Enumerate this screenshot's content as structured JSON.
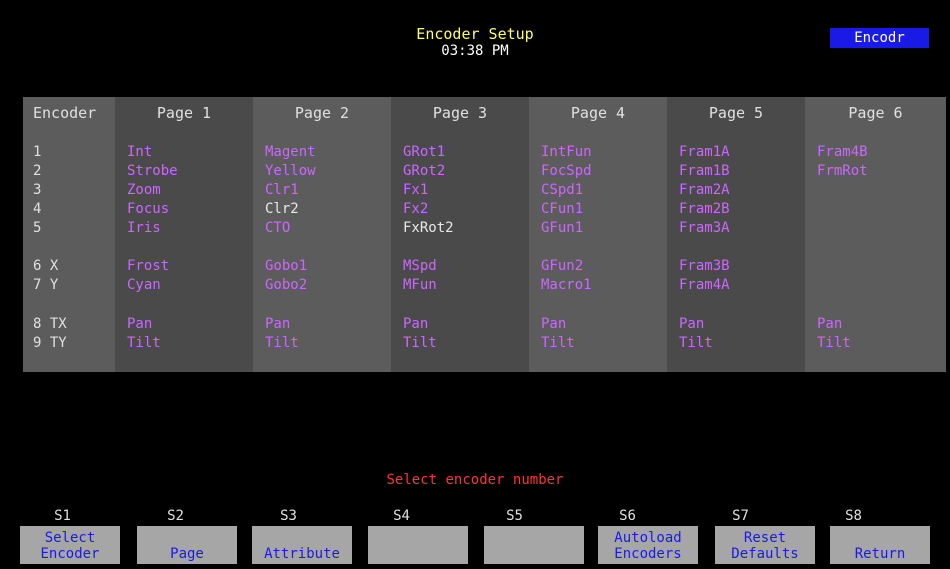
{
  "header": {
    "title": "Encoder Setup",
    "time": "03:38 PM",
    "mode": "Encodr"
  },
  "table": {
    "encoder_header": "Encoder",
    "encoder_labels": [
      "1",
      "2",
      "3",
      "4",
      "5",
      "6 X",
      "7 Y",
      "8 TX",
      "9 TY"
    ],
    "pages": [
      {
        "label": "Page 1",
        "cells": [
          "Int",
          "Strobe",
          "Zoom",
          "Focus",
          "Iris",
          "Frost",
          "Cyan",
          "Pan",
          "Tilt"
        ]
      },
      {
        "label": "Page 2",
        "cells": [
          "Magent",
          "Yellow",
          "Clr1",
          "Clr2",
          "CTO",
          "Gobo1",
          "Gobo2",
          "Pan",
          "Tilt"
        ]
      },
      {
        "label": "Page 3",
        "cells": [
          "GRot1",
          "GRot2",
          "Fx1",
          "Fx2",
          "FxRot2",
          "MSpd",
          "MFun",
          "Pan",
          "Tilt"
        ]
      },
      {
        "label": "Page 4",
        "cells": [
          "IntFun",
          "FocSpd",
          "CSpd1",
          "CFun1",
          "GFun1",
          "GFun2",
          "Macro1",
          "Pan",
          "Tilt"
        ]
      },
      {
        "label": "Page 5",
        "cells": [
          "Fram1A",
          "Fram1B",
          "Fram2A",
          "Fram2B",
          "Fram3A",
          "Fram3B",
          "Fram4A",
          "Pan",
          "Tilt"
        ]
      },
      {
        "label": "Page 6",
        "cells": [
          "Fram4B",
          "FrmRot",
          "",
          "",
          "",
          "",
          "",
          "Pan",
          "Tilt"
        ]
      }
    ],
    "white_cells": [
      "Clr2",
      "FxRot2"
    ]
  },
  "prompt": "Select encoder number",
  "softkeys": [
    {
      "num": "S1",
      "lines": [
        "Select",
        "Encoder"
      ]
    },
    {
      "num": "S2",
      "lines": [
        "Page"
      ]
    },
    {
      "num": "S3",
      "lines": [
        "Attribute"
      ]
    },
    {
      "num": "S4",
      "lines": []
    },
    {
      "num": "S5",
      "lines": []
    },
    {
      "num": "S6",
      "lines": [
        "Autoload",
        "Encoders"
      ]
    },
    {
      "num": "S7",
      "lines": [
        "Reset",
        "Defaults"
      ]
    },
    {
      "num": "S8",
      "lines": [
        "Return"
      ]
    }
  ],
  "colors": {
    "background": "#000000",
    "attribute_text": "#cc66ff",
    "title_text": "#ffff66",
    "prompt_text": "#ff3333",
    "badge_bg": "#1a1ae6",
    "softkey_bg": "#a6a6a6",
    "softkey_text": "#1a1ae6"
  }
}
